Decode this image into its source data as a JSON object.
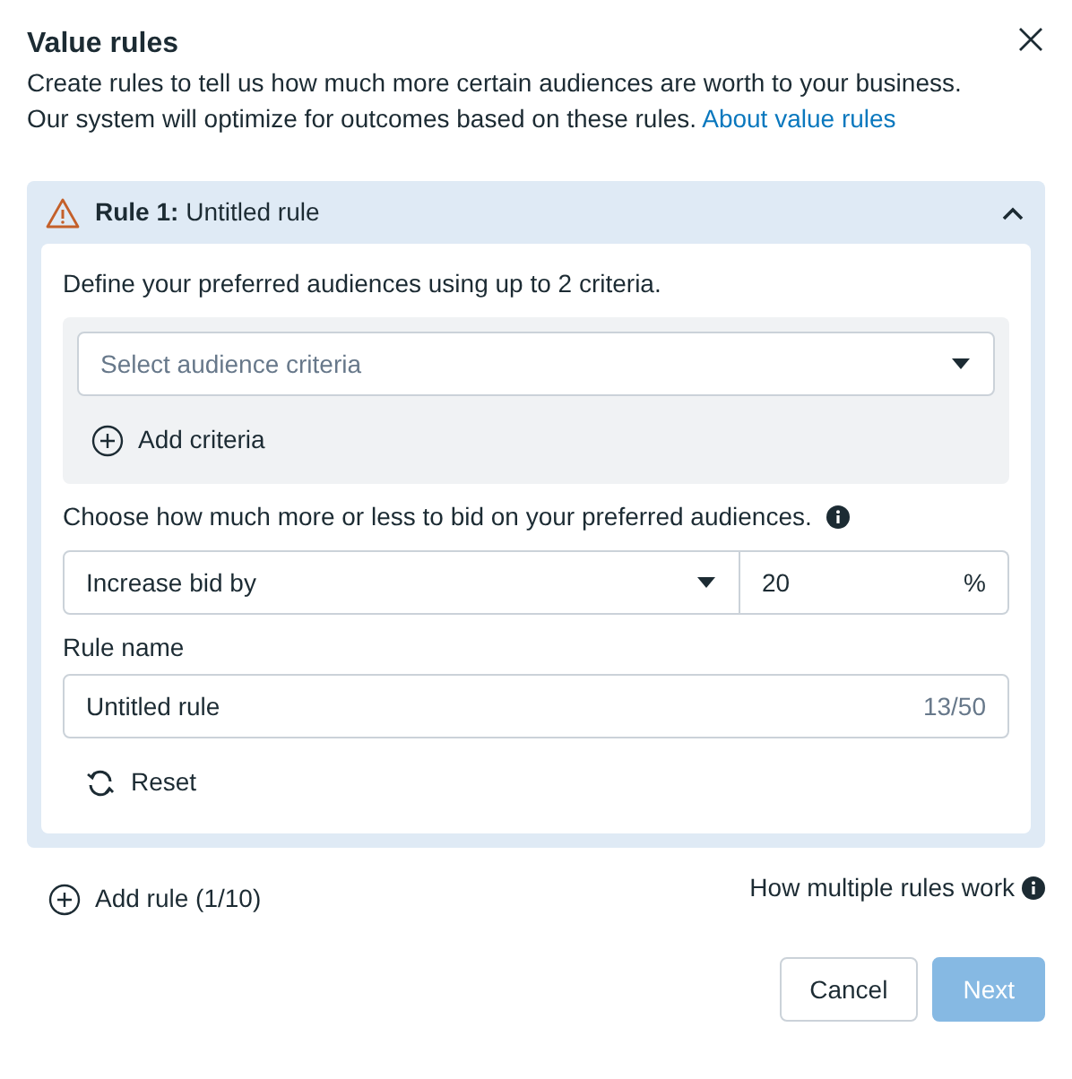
{
  "dialog": {
    "title": "Value rules",
    "description": "Create rules to tell us how much more certain audiences are worth to your business. Our system will optimize for outcomes based on these rules.",
    "link": "About value rules"
  },
  "rules": [
    {
      "header": "**Rule 1:** Untitled rule",
      "expanded": true,
      "warning": true,
      "criteria_label": "Define your preferred audiences using up to 2 criteria.",
      "criteria_select": {
        "placeholder": "Select audience criteria"
      },
      "add_criteria": "Add criteria",
      "bid_label": "Choose how much more or less to bid on your preferred audiences.",
      "bid_select": "Increase bid by",
      "bid_value": "20",
      "bid_unit": "%",
      "name_label": "Rule name",
      "name_value": "Untitled rule",
      "name_count": "13/50",
      "reset": "Reset"
    }
  ],
  "add_rule": "Add rule (1/10)",
  "help_link": "How multiple rules work",
  "buttons": [
    {
      "label": "Cancel",
      "kind": "secondary",
      "disabled": false
    },
    {
      "label": "Next",
      "kind": "primary",
      "disabled": true
    }
  ]
}
